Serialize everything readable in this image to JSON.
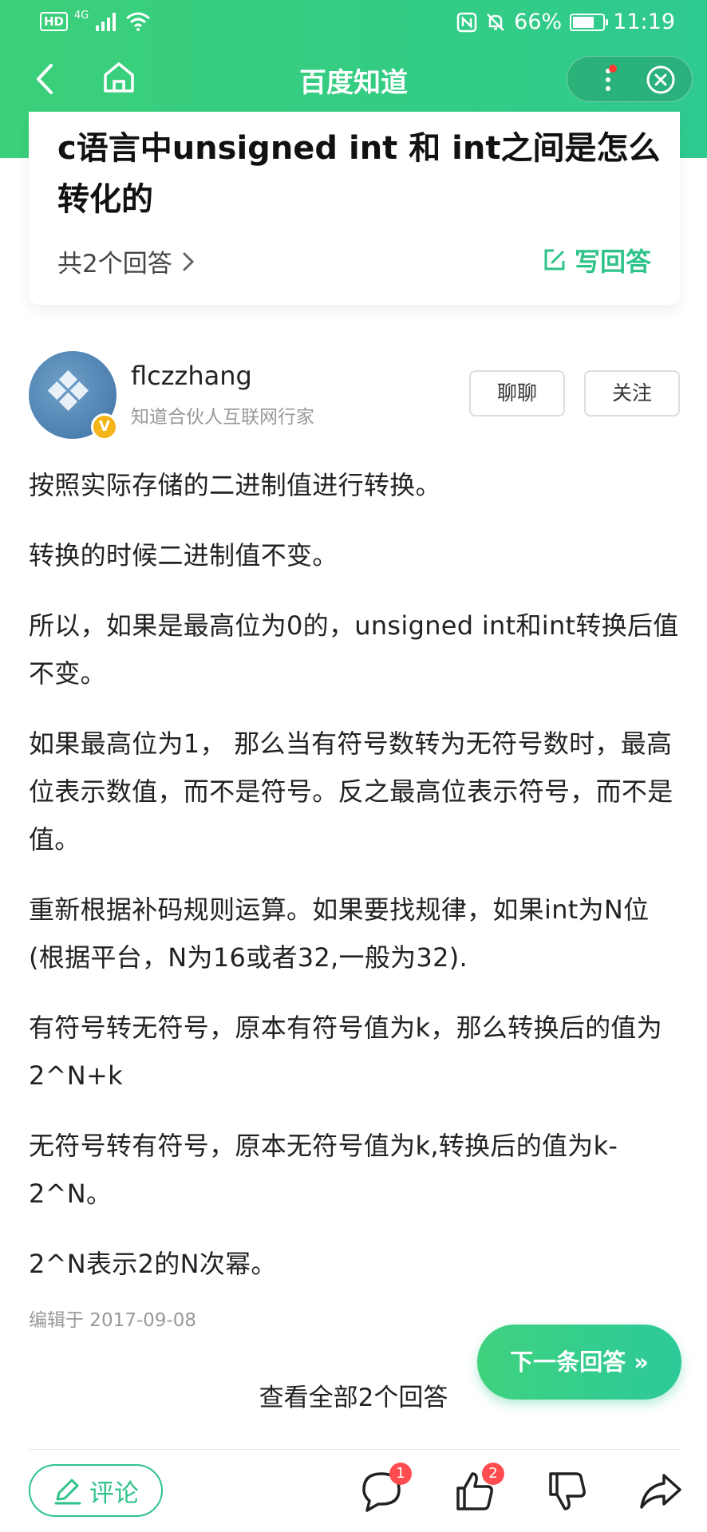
{
  "status_bar": {
    "hd": "HD",
    "network": "4G",
    "battery": "66%",
    "time": "11:19"
  },
  "nav": {
    "title": "百度知道"
  },
  "question": {
    "title": "c语言中unsigned int 和 int之间是怎么转化的",
    "answer_count": "共2个回答",
    "write_answer": "写回答"
  },
  "answerer": {
    "name": "flczzhang",
    "subtitle": "知道合伙人互联网行家",
    "badge": "V",
    "chat_label": "聊聊",
    "follow_label": "关注"
  },
  "answer": {
    "paragraphs": [
      "按照实际存储的二进制值进行转换。",
      "转换的时候二进制值不变。",
      "所以，如果是最高位为0的，unsigned int和int转换后值不变。",
      "如果最高位为1， 那么当有符号数转为无符号数时，最高位表示数值，而不是符号。反之最高位表示符号，而不是值。",
      "重新根据补码规则运算。如果要找规律，如果int为N位(根据平台，N为16或者32,一般为32).",
      "有符号转无符号，原本有符号值为k，那么转换后的值为2^N+k",
      "无符号转有符号，原本无符号值为k,转换后的值为k-2^N。",
      "2^N表示2的N次幂。"
    ],
    "edit_date": "编辑于 2017-09-08"
  },
  "next_answer": "下一条回答",
  "view_all": "查看全部2个回答",
  "bottom_bar": {
    "comment_label": "评论",
    "comments_badge": "1",
    "likes_badge": "2"
  },
  "colors": {
    "brand_green": "#2fc38a",
    "badge_red": "#ff4d4f"
  }
}
